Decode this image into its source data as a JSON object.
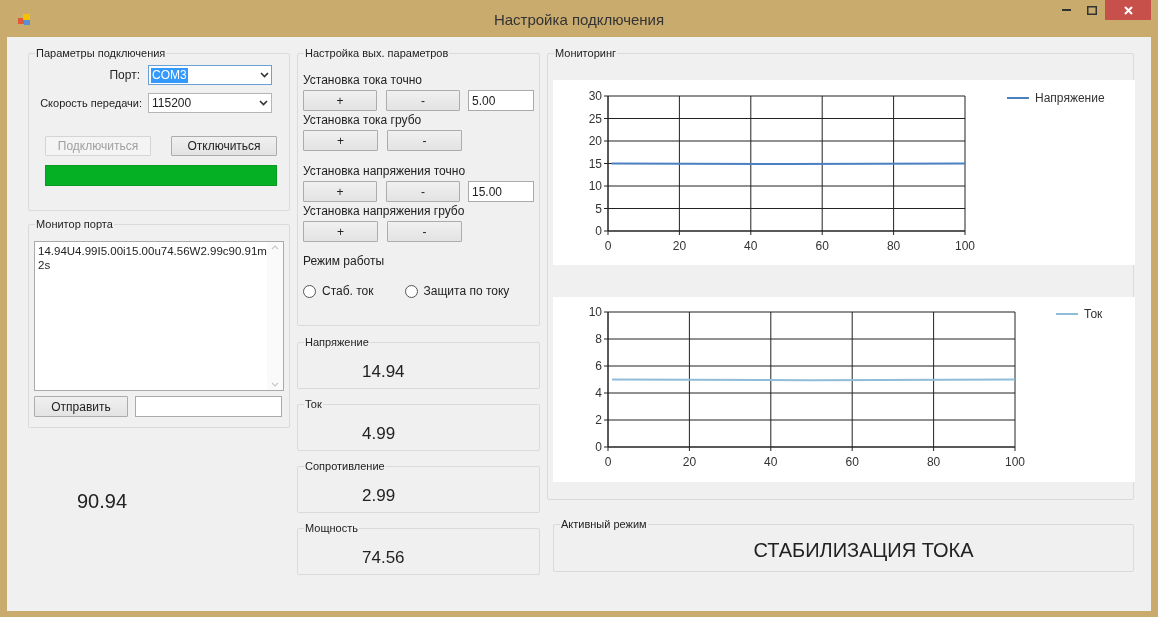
{
  "window": {
    "title": "Настройка подключения"
  },
  "connection": {
    "legend": "Параметры подключения",
    "port_label": "Порт:",
    "port_value": "COM3",
    "speed_label": "Скорость передачи:",
    "speed_value": "115200",
    "buttons": [
      {
        "label": "Подключиться",
        "disabled": true
      },
      {
        "label": "Отключиться",
        "disabled": false
      }
    ],
    "indicator": {
      "on": true
    }
  },
  "port_monitor": {
    "legend": "Монитор порта",
    "log": "14.94U4.99I5.00i15.00u74.56W2.99c90.91m2s",
    "send_button": "Отправить"
  },
  "standalone_value": "90.94",
  "output_settings": {
    "legend": "Настройка вых. параметров",
    "rows": [
      {
        "label": "Установка тока точно",
        "buttons": [
          "+",
          "-"
        ],
        "value": "5.00"
      },
      {
        "label": "Установка тока грубо",
        "buttons": [
          "+",
          "-"
        ]
      },
      {
        "label": "Установка напряжения точно",
        "buttons": [
          "+",
          "-"
        ],
        "value": "15.00"
      },
      {
        "label": "Установка напряжения грубо",
        "buttons": [
          "+",
          "-"
        ]
      }
    ],
    "mode_label": "Режим работы",
    "modes": [
      {
        "label": "Стаб. ток",
        "selected": false
      },
      {
        "label": "Защита по току",
        "selected": false
      }
    ]
  },
  "readings": [
    {
      "legend": "Напряжение",
      "value": "14.94"
    },
    {
      "legend": "Ток",
      "value": "4.99"
    },
    {
      "legend": "Сопротивление",
      "value": "2.99"
    },
    {
      "legend": "Мощность",
      "value": "74.56"
    }
  ],
  "monitoring": {
    "legend": "Мониторинг",
    "charts": [
      {
        "chart_data": {
          "type": "line",
          "grid": true,
          "x": [
            1,
            50,
            100
          ],
          "xlim": [
            0,
            100
          ],
          "ylim": [
            0,
            30
          ],
          "xticks": [
            0,
            20,
            40,
            60,
            80,
            100
          ],
          "yticks": [
            0,
            5,
            10,
            15,
            20,
            25,
            30
          ],
          "series": [
            {
              "name": "Напряжение",
              "color": "#4a7fc0",
              "values": [
                15,
                14.9,
                15
              ]
            }
          ]
        }
      },
      {
        "chart_data": {
          "type": "line",
          "grid": true,
          "x": [
            1,
            50,
            100
          ],
          "xlim": [
            0,
            100
          ],
          "ylim": [
            0,
            10
          ],
          "xticks": [
            0,
            20,
            40,
            60,
            80,
            100
          ],
          "yticks": [
            0,
            2,
            4,
            6,
            8,
            10
          ],
          "series": [
            {
              "name": "Ток",
              "color": "#8fbcd8",
              "values": [
                5,
                4.95,
                5
              ]
            }
          ]
        }
      }
    ]
  },
  "active_mode": {
    "legend": "Активный режим",
    "value": "СТАБИЛИЗАЦИЯ ТОКА"
  }
}
